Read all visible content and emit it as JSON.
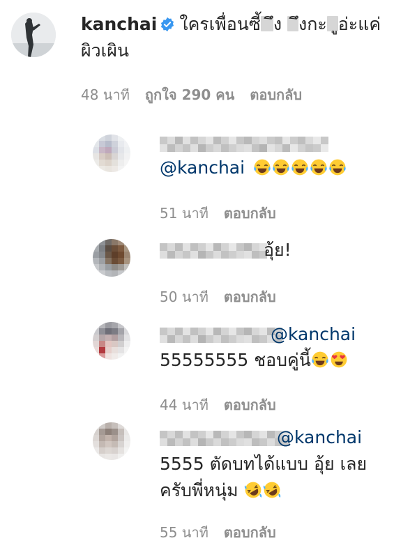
{
  "main_comment": {
    "username": "kanchai",
    "text_part1": "ใครเพื่อนซี้",
    "text_part2": "ึง",
    "text_part3": "ึงกะ",
    "text_part4": "ูอ่ะแค่",
    "text_line2": "ผิวเผิน",
    "time": "48 นาที",
    "likes": "ถูกใจ 290 คน",
    "reply_label": "ตอบกลับ"
  },
  "replies": [
    {
      "mention": "@kanchai",
      "text": "",
      "emoji_count": 5,
      "time": "51 นาที",
      "reply_label": "ตอบกลับ"
    },
    {
      "text": "อุ้ย!",
      "time": "50 นาที",
      "reply_label": "ตอบกลับ"
    },
    {
      "mention": "@kanchai",
      "text": "55555555 ชอบคู่นี้",
      "time": "44 นาที",
      "reply_label": "ตอบกลับ"
    },
    {
      "mention": "@kanchai",
      "text_line1": "5555 ตัดบทได้แบบ อุ้ย เลย",
      "text_line2": "ครับพี่หนุ่ม",
      "time": "55 นาที",
      "reply_label": "ตอบกลับ"
    }
  ],
  "colors": {
    "text": "#262626",
    "meta": "#8e8e8e",
    "mention": "#00376b",
    "verified": "#3897f0"
  },
  "icons": {
    "verified": "verified-badge-icon",
    "laughing": "face-with-tears-of-joy-emoji",
    "heart_eyes": "smiling-face-with-heart-eyes-emoji",
    "rofl": "rolling-on-the-floor-laughing-emoji"
  }
}
